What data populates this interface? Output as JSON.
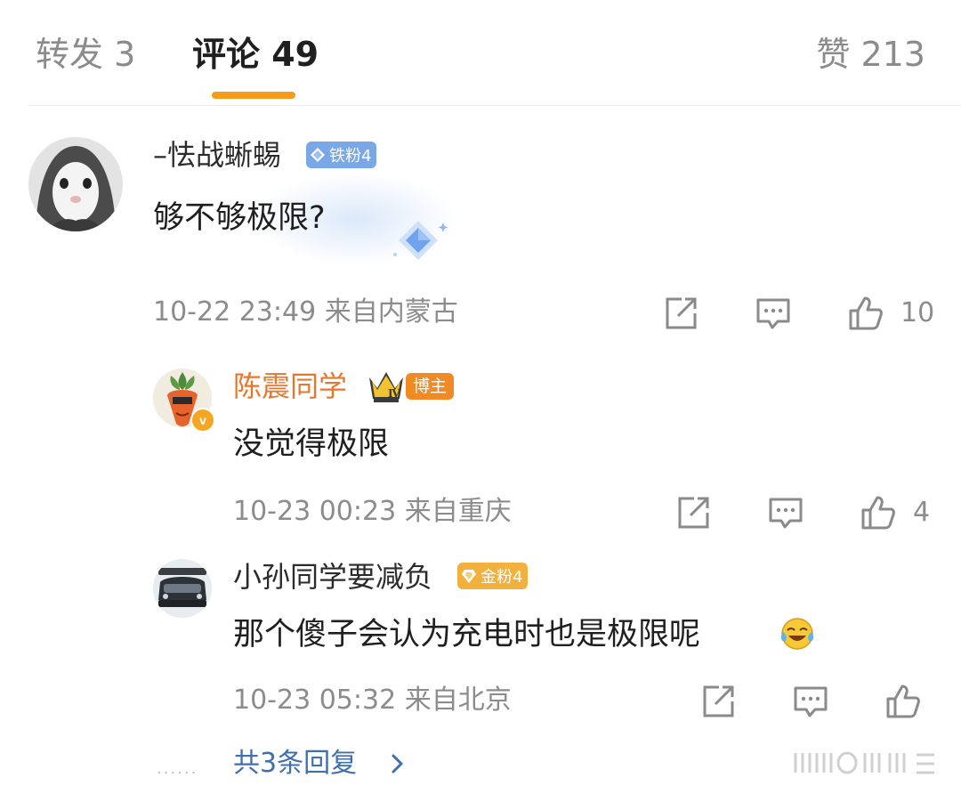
{
  "tabs": {
    "repost": "转发 3",
    "comment": "评论 49",
    "like": "赞 213"
  },
  "colors": {
    "accent": "#f59c1a",
    "link": "#3f6fae",
    "blogger_name": "#e8772e",
    "muted": "#8c8c8c"
  },
  "comments": [
    {
      "user": "–怯战蜥蜴",
      "badge": "铁粉4",
      "text": "够不够极限?",
      "time": "10-22 23:49",
      "location": "来自内蒙古",
      "likes": "10"
    },
    {
      "user": "陈震同学",
      "badge": "博主",
      "level": "Ⅳ",
      "verified": "v",
      "text": "没觉得极限",
      "time": "10-23 00:23",
      "location": "来自重庆",
      "likes": "4"
    },
    {
      "user": "小孙同学要减负",
      "badge": "金粉4",
      "text": "那个傻子会认为充电时也是极限呢",
      "emoji": "laugh-cry-emoji",
      "time": "10-23 05:32",
      "location": "来自北京",
      "likes": ""
    }
  ],
  "replies": {
    "dots": "······",
    "label": "共3条回复"
  },
  "icons": [
    "share-icon",
    "comment-icon",
    "thumbs-up-icon",
    "chevron-right-icon"
  ]
}
